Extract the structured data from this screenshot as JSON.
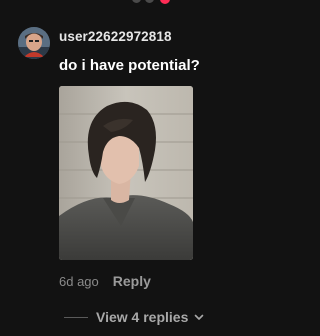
{
  "comment": {
    "username": "user22622972818",
    "text": "do i have potential?",
    "timestamp": "6d ago",
    "reply_label": "Reply",
    "view_replies_label": "View 4 replies"
  },
  "icons": {
    "avatar": "user-avatar-icon",
    "chevron": "chevron-down-icon"
  },
  "colors": {
    "background": "#121212",
    "username": "#e6e6e6",
    "text": "#ffffff",
    "muted": "#8a8a8a",
    "notification_badge": "#fe2c55"
  }
}
